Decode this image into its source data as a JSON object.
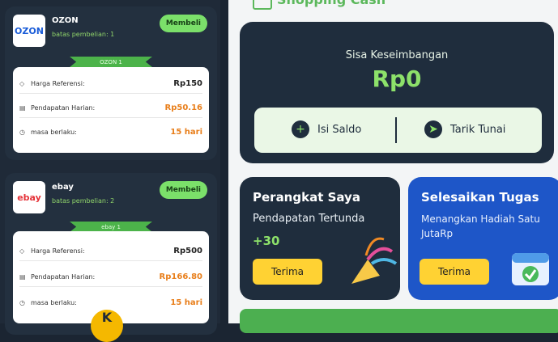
{
  "left_panel": {
    "products": [
      {
        "logo_text": "OZON",
        "name": "OZON",
        "limit": "batas pembelian: 1",
        "buy": "Membeli",
        "ribbon": "OZON 1",
        "rows": [
          {
            "label": "Harga Referensi:",
            "value": "Rp150"
          },
          {
            "label": "Pendapatan Harian:",
            "value": "Rp50.16"
          },
          {
            "label": "masa berlaku:",
            "value": "15 hari"
          }
        ]
      },
      {
        "logo_text": "ebay",
        "name": "ebay",
        "limit": "batas pembelian: 2",
        "buy": "Membeli",
        "ribbon": "ebay 1",
        "rows": [
          {
            "label": "Harga Referensi:",
            "value": "Rp500"
          },
          {
            "label": "Pendapatan Harian:",
            "value": "Rp166.80"
          },
          {
            "label": "masa berlaku:",
            "value": "15 hari"
          }
        ]
      }
    ]
  },
  "right_panel": {
    "header_title": "Shopping Cash",
    "balance": {
      "label": "Sisa Keseimbangan",
      "amount": "Rp0"
    },
    "actions": [
      {
        "label": "Isi Saldo",
        "icon": "plus-icon"
      },
      {
        "label": "Tarik Tunai",
        "icon": "send-icon"
      }
    ],
    "tiles": [
      {
        "title": "Perangkat Saya",
        "subtitle": "Pendapatan Tertunda",
        "value": "+30",
        "button": "Terima"
      },
      {
        "title": "Selesaikan Tugas",
        "subtitle": "Menangkan Hadiah Satu JutaRp",
        "button": "Terima"
      }
    ]
  },
  "colors": {
    "dark": "#1f2d3d",
    "green": "#8de16a",
    "blue": "#1e56c8",
    "yellow": "#ffd233",
    "orange": "#e87e1a"
  }
}
